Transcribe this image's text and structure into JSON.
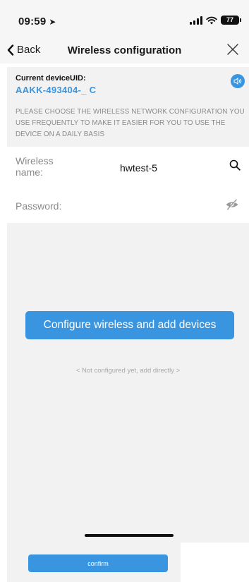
{
  "status_bar": {
    "time": "09:59",
    "battery_level": "77"
  },
  "nav": {
    "back_label": "Back",
    "title": "Wireless configuration"
  },
  "device": {
    "uid_label": "Current deviceUID:",
    "uid_value": "AAKK-493404-_ C",
    "note": "PLEASE CHOOSE THE WIRELESS NETWORK CONFIGURATION YOU USE FREQUENTLY TO MAKE IT EASIER FOR YOU TO USE THE DEVICE ON A DAILY BASIS"
  },
  "form": {
    "wireless_label_line1": "Wireless",
    "wireless_label_line2": "name:",
    "wireless_value": "hwtest-5",
    "password_label": "Password:",
    "password_value": ""
  },
  "actions": {
    "configure_label": "Configure wireless and add devices",
    "not_configured_label": "< Not configured yet, add directly >",
    "confirm_label": "confirm"
  },
  "colors": {
    "accent": "#3a95e0",
    "panel_bg": "#f2f2f2"
  },
  "icons": [
    "location-arrow-icon",
    "signal-icon",
    "wifi-icon",
    "battery-icon",
    "back-chevron-icon",
    "close-icon",
    "speaker-icon",
    "search-icon",
    "eye-hidden-icon"
  ]
}
